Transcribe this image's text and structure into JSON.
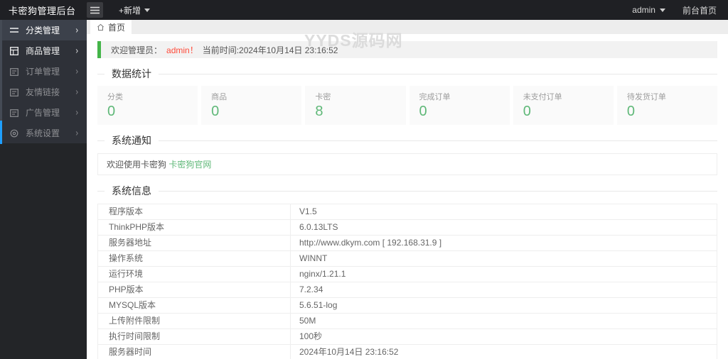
{
  "header": {
    "title": "卡密狗管理后台",
    "add_button": "+新增",
    "user": "admin",
    "front_link": "前台首页"
  },
  "tabs": {
    "home": "首页"
  },
  "watermark": "YYDS源码网",
  "sidebar": {
    "items": [
      {
        "label": "分类管理",
        "icon": "list-icon"
      },
      {
        "label": "商品管理",
        "icon": "grid-icon"
      },
      {
        "label": "订单管理",
        "icon": "form-icon"
      },
      {
        "label": "友情链接",
        "icon": "link-icon"
      },
      {
        "label": "广告管理",
        "icon": "ad-icon"
      },
      {
        "label": "系统设置",
        "icon": "gear-icon"
      }
    ]
  },
  "welcome": {
    "prefix": "欢迎管理员：",
    "user": "admin！",
    "time_text": "当前时间:2024年10月14日 23:16:52"
  },
  "stats": {
    "title": "数据统计",
    "cards": [
      {
        "label": "分类",
        "value": "0"
      },
      {
        "label": "商品",
        "value": "0"
      },
      {
        "label": "卡密",
        "value": "8"
      },
      {
        "label": "完成订单",
        "value": "0"
      },
      {
        "label": "未支付订单",
        "value": "0"
      },
      {
        "label": "待发货订单",
        "value": "0"
      }
    ]
  },
  "notice": {
    "title": "系统通知",
    "text": "欢迎使用卡密狗 ",
    "link": "卡密狗官网"
  },
  "system_info": {
    "title": "系统信息",
    "rows": [
      {
        "label": "程序版本",
        "value": "V1.5"
      },
      {
        "label": "ThinkPHP版本",
        "value": "6.0.13LTS"
      },
      {
        "label": "服务器地址",
        "value": "http://www.dkym.com [ 192.168.31.9 ]"
      },
      {
        "label": "操作系统",
        "value": "WINNT"
      },
      {
        "label": "运行环境",
        "value": "nginx/1.21.1"
      },
      {
        "label": "PHP版本",
        "value": "7.2.34"
      },
      {
        "label": "MYSQL版本",
        "value": "5.6.51-log"
      },
      {
        "label": "上传附件限制",
        "value": "50M"
      },
      {
        "label": "执行时间限制",
        "value": "100秒"
      },
      {
        "label": "服务器时间",
        "value": "2024年10月14日 23:16:52"
      }
    ]
  },
  "colors": {
    "accent_green": "#5FB878",
    "alert_border_green": "#44b549",
    "alert_red": "#FF4B3A",
    "scrollbar_blue": "#1E9FFF",
    "header_bg": "#1f2024",
    "sidebar_bg": "#2e3138"
  }
}
